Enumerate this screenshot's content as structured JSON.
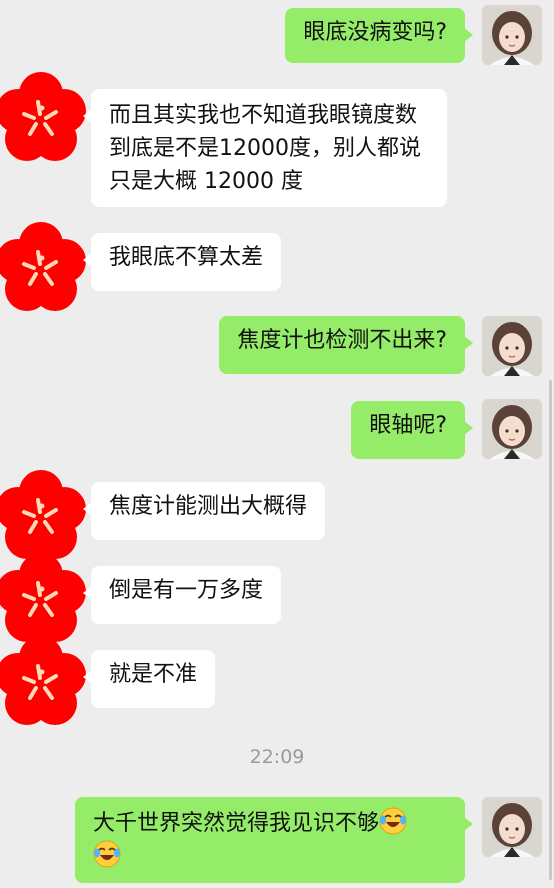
{
  "messages": [
    {
      "sender": "me",
      "text": "眼底没病变吗?"
    },
    {
      "sender": "other",
      "lines": [
        "而且其实我也不知道我眼镜度数",
        "到底是不是12000度，别人都说",
        "只是大概 12000 度"
      ]
    },
    {
      "sender": "other",
      "text": "我眼底不算太差"
    },
    {
      "sender": "me",
      "text": "焦度计也检测不出来?"
    },
    {
      "sender": "me",
      "text": "眼轴呢?"
    },
    {
      "sender": "other",
      "text": "焦度计能测出大概得"
    },
    {
      "sender": "other",
      "text": "倒是有一万多度"
    },
    {
      "sender": "other",
      "text": "就是不准"
    },
    {
      "sender": "me",
      "line1": "大千世界突然觉得我见识不够"
    }
  ],
  "timestamp": "22:09",
  "icons": {
    "me_avatar": "girl-avatar-icon",
    "other_avatar": "red-plum-blossom-icon",
    "emoji": "laughing-crying-emoji-icon"
  },
  "colors": {
    "background": "#ededed",
    "my_bubble": "#95ec69",
    "other_bubble": "#ffffff",
    "flower": "#ff0000"
  }
}
